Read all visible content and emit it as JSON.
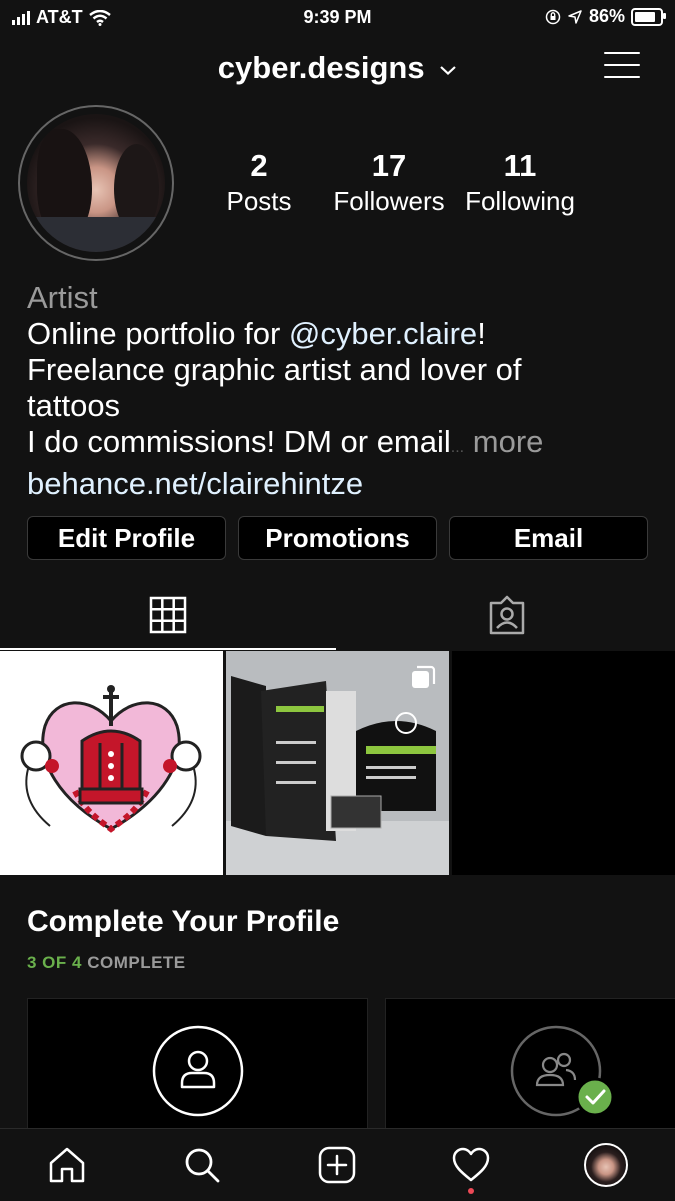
{
  "status_bar": {
    "carrier": "AT&T",
    "time": "9:39 PM",
    "battery": "86%"
  },
  "header": {
    "username": "cyber.designs",
    "dropdown_icon": "chevron-down-icon",
    "menu_icon": "menu-icon"
  },
  "profile": {
    "stats": [
      {
        "value": "2",
        "label": "Posts"
      },
      {
        "value": "17",
        "label": "Followers"
      },
      {
        "value": "11",
        "label": "Following"
      }
    ],
    "bio": {
      "category": "Artist",
      "line1_prefix": "Online portfolio for ",
      "mention": "@cyber.claire",
      "line1_suffix": "!",
      "line2": "Freelance graphic artist and lover of",
      "line3": "tattoos",
      "line4": "I do commissions! DM or email",
      "ellipsis": "...",
      "more": "more",
      "link": "behance.net/clairehintze"
    }
  },
  "actions": {
    "edit_profile": "Edit Profile",
    "promotions": "Promotions",
    "email": "Email"
  },
  "tabs": [
    {
      "icon": "grid-icon"
    },
    {
      "icon": "tagged-icon"
    }
  ],
  "complete_profile": {
    "title": "Complete Your Profile",
    "progress_done": "3 OF 4",
    "progress_suffix": " COMPLETE"
  },
  "bottom_nav": [
    {
      "icon": "home-icon"
    },
    {
      "icon": "search-icon"
    },
    {
      "icon": "add-post-icon"
    },
    {
      "icon": "heart-icon"
    },
    {
      "icon": "profile-avatar"
    }
  ],
  "colors": {
    "background": "#121212",
    "link": "#e0f1ff",
    "muted": "#9a9a9a",
    "success": "#6ab04c",
    "notification": "#ed4956"
  }
}
